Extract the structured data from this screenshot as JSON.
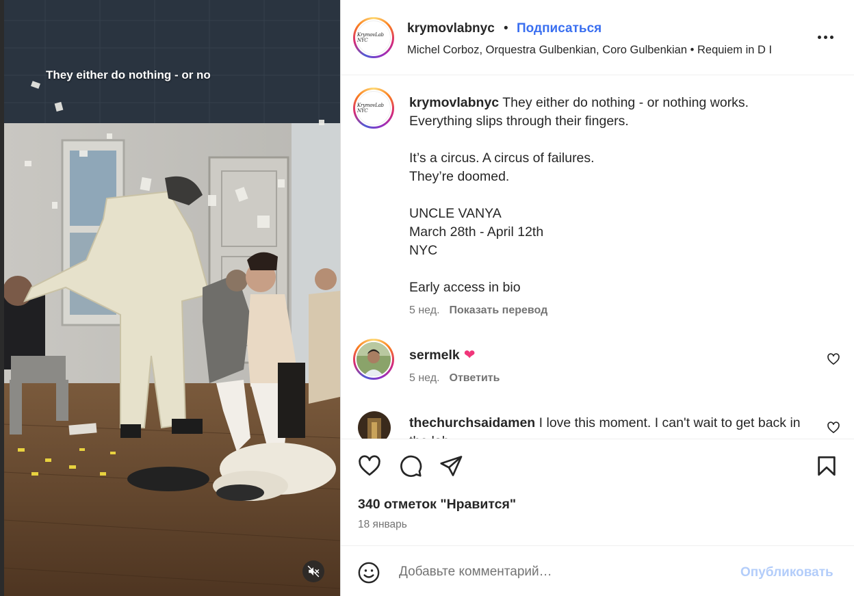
{
  "media": {
    "overlay_text": "They either do nothing - or no",
    "mute_icon": "speaker-muted-icon"
  },
  "header": {
    "avatar_text": "KrymovLab NYC",
    "username": "krymovlabnyc",
    "separator": "•",
    "follow_label": "Подписаться",
    "audio": "Michel Corboz, Orquestra Gulbenkian, Coro Gulbenkian • Requiem in D I",
    "more_icon": "more-horizontal-icon"
  },
  "caption": {
    "username": "krymovlabnyc",
    "lines": [
      "They either do nothing - or nothing works.",
      "Everything slips through their fingers.",
      "",
      "It’s a circus. A circus of failures.",
      "They’re doomed.",
      "",
      "UNCLE VANYA",
      "March 28th - April 12th",
      "NYC",
      "",
      "Early access in bio"
    ],
    "age": "5 нед.",
    "translate_label": "Показать перевод"
  },
  "comments": [
    {
      "username": "sermelk",
      "text": "",
      "emoji": "❤",
      "age": "5 нед.",
      "reply_label": "Ответить"
    },
    {
      "username": "thechurchsaidamen",
      "text": "I love this moment. I can't wait to get back in the lab"
    }
  ],
  "actions": {
    "like_icon": "heart-icon",
    "comment_icon": "comment-icon",
    "share_icon": "send-icon",
    "save_icon": "bookmark-icon"
  },
  "likes_text": "340 отметок \"Нравится\"",
  "date_text": "18 январь",
  "composer": {
    "emoji_icon": "smiley-icon",
    "placeholder": "Добавьте комментарий…",
    "post_label": "Опубликовать"
  },
  "colors": {
    "link_blue": "#3a6ff0",
    "post_disabled": "#b3cdfa",
    "heart_pink": "#f0367a",
    "muted_text": "#737373"
  }
}
